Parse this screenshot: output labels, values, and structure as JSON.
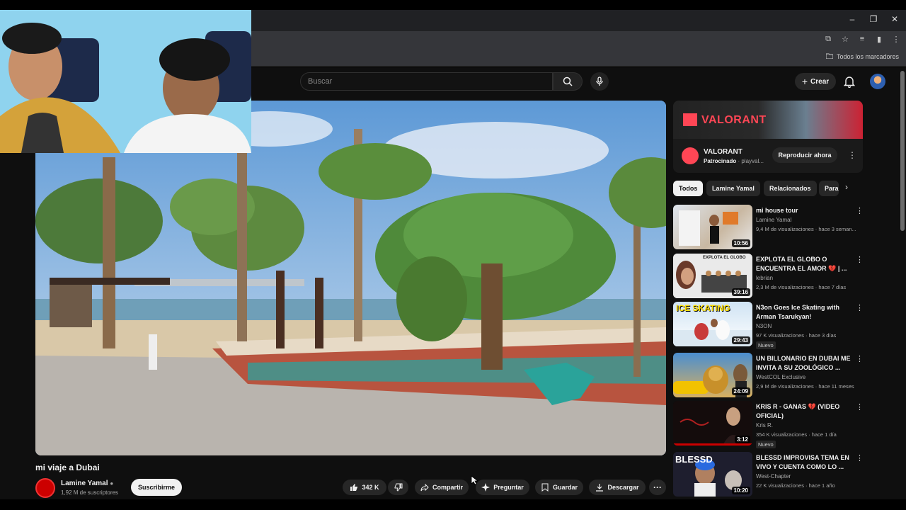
{
  "browser": {
    "bookmarks_label": "Todos los marcadores"
  },
  "header": {
    "search_placeholder": "Buscar",
    "create_label": "Crear"
  },
  "video": {
    "title": "mi viaje a Dubai",
    "channel": "Lamine Yamal",
    "subscribers": "1,92 M de suscriptores",
    "subscribe_label": "Suscribirme",
    "likes": "342 K",
    "share_label": "Compartir",
    "ask_label": "Preguntar",
    "save_label": "Guardar",
    "download_label": "Descargar"
  },
  "ad": {
    "banner_text": "VALORANT",
    "title": "VALORANT",
    "sponsor_label": "Patrocinado",
    "sponsor_domain": "playval...",
    "cta": "Reproducir ahora"
  },
  "chips": [
    "Todos",
    "Lamine Yamal",
    "Relacionados",
    "Para"
  ],
  "recommendations": [
    {
      "title": "mi house tour",
      "channel": "Lamine Yamal",
      "meta": "9,4 M de visualizaciones · hace 3 seman...",
      "duration": "10:56",
      "badge": ""
    },
    {
      "title": "EXPLOTA EL GLOBO O ENCUENTRA EL AMOR 💔 | ...",
      "channel": "lebrian",
      "meta": "2,3 M de visualizaciones · hace 7 días",
      "duration": "39:16",
      "badge": ""
    },
    {
      "title": "N3on Goes Ice Skating with Arman Tsarukyan!",
      "channel": "N3ON",
      "meta": "97 K visualizaciones · hace 3 días",
      "duration": "29:43",
      "badge": "Nuevo"
    },
    {
      "title": "UN BILLONARIO EN DUBAI ME INVITA A SU ZOOLÓGICO ...",
      "channel": "WestCOL Exclusive",
      "meta": "2,9 M de visualizaciones · hace 11 meses",
      "duration": "24:09",
      "badge": ""
    },
    {
      "title": "KRIS R - GANAS 💔 (VIDEO OFICIAL)",
      "channel": "Kris R.",
      "meta": "354 K visualizaciones · hace 1 día",
      "duration": "3:12",
      "badge": "Nuevo"
    },
    {
      "title": "BLESSD IMPROVISA TEMA EN VIVO Y CUENTA COMO LO ...",
      "channel": "West-Chapter",
      "meta": "22 K visualizaciones · hace 1 año",
      "duration": "10:20",
      "badge": ""
    }
  ],
  "thumb_texts": {
    "rec2_overlay": "EXPLOTA EL GLOBO",
    "rec3_overlay": "ICE SKATING",
    "rec6_overlay": "BLESSD"
  },
  "colors": {
    "page_bg": "#0f0f0f",
    "valorant_red": "#ff4655",
    "channel_red": "#cc0000"
  }
}
